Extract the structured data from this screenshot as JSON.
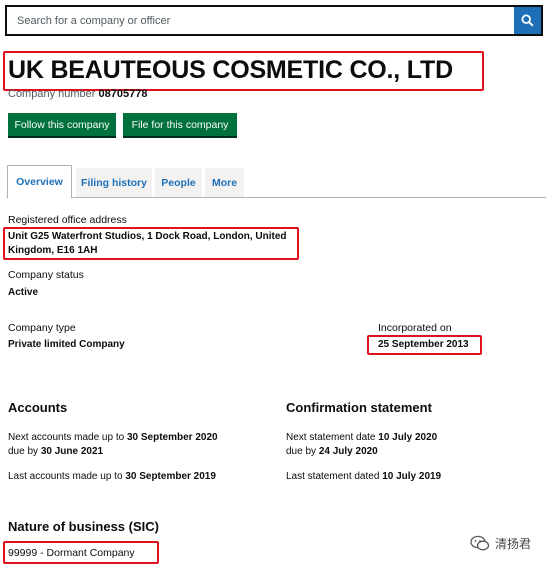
{
  "search": {
    "placeholder": "Search for a company or officer"
  },
  "company": {
    "name": "UK BEAUTEOUS COSMETIC CO., LTD",
    "number_label": "Company number",
    "number": "08705778"
  },
  "actions": {
    "follow_label": "Follow this company",
    "file_label": "File for this company"
  },
  "tabs": [
    {
      "label": "Overview"
    },
    {
      "label": "Filing history"
    },
    {
      "label": "People"
    },
    {
      "label": "More"
    }
  ],
  "overview": {
    "registered_office_label": "Registered office address",
    "registered_office": "Unit G25 Waterfront Studios, 1 Dock Road, London, United Kingdom, E16 1AH",
    "status_label": "Company status",
    "status": "Active",
    "type_label": "Company type",
    "type": "Private limited Company",
    "incorporated_label": "Incorporated on",
    "incorporated": "25 September 2013"
  },
  "accounts": {
    "heading": "Accounts",
    "next_prefix": "Next accounts made up to",
    "next_date": "30 September 2020",
    "due_prefix": "due by",
    "due_date": "30 June 2021",
    "last_prefix": "Last accounts made up to",
    "last_date": "30 September 2019"
  },
  "confirmation": {
    "heading": "Confirmation statement",
    "next_prefix": "Next statement date",
    "next_date": "10 July 2020",
    "due_prefix": "due by",
    "due_date": "24 July 2020",
    "last_prefix": "Last statement dated",
    "last_date": "10 July 2019"
  },
  "sic": {
    "heading": "Nature of business (SIC)",
    "entry": "99999 - Dormant Company"
  },
  "watermark": {
    "text": "清扬君"
  },
  "colors": {
    "link_blue": "#1d70b8",
    "button_green": "#00703c",
    "highlight_red": "#e0101e"
  }
}
